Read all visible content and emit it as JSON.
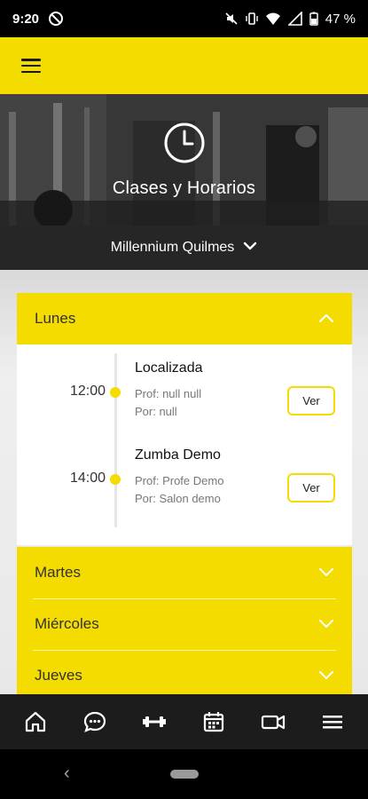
{
  "status_bar": {
    "time": "9:20",
    "battery": "47 %"
  },
  "hero": {
    "title": "Clases y Horarios",
    "icon": "clock-icon"
  },
  "location": {
    "name": "Millennium Quilmes"
  },
  "expanded_day": {
    "name": "Lunes",
    "classes": [
      {
        "time": "12:00",
        "name": "Localizada",
        "prof": "Prof: null null",
        "room": "Por: null",
        "button": "Ver"
      },
      {
        "time": "14:00",
        "name": "Zumba Demo",
        "prof": "Prof: Profe Demo",
        "room": "Por: Salon demo",
        "button": "Ver"
      }
    ]
  },
  "collapsed_days": [
    "Martes",
    "Miércoles",
    "Jueves"
  ],
  "bottom_nav": [
    "home-icon",
    "chat-icon",
    "dumbbell-icon",
    "calendar-icon",
    "video-icon",
    "menu-icon"
  ],
  "colors": {
    "accent": "#f4dc00",
    "dark": "#262626"
  }
}
